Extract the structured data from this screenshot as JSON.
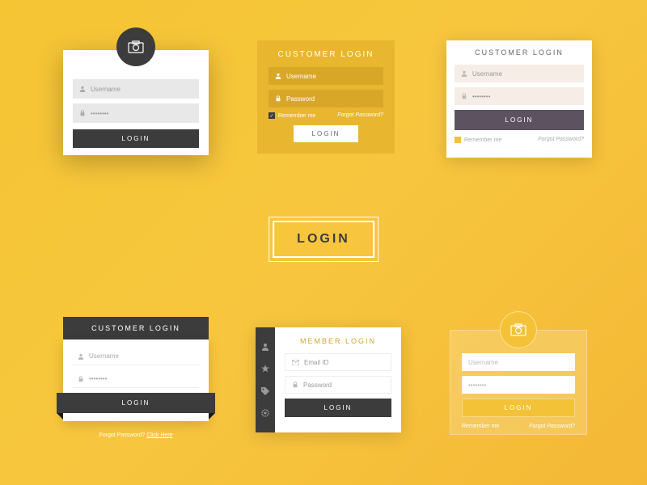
{
  "center": {
    "label": "LOGIN"
  },
  "card1": {
    "username_placeholder": "Username",
    "password_value": "••••••••",
    "login_label": "LOGIN"
  },
  "card2": {
    "title": "CUSTOMER LOGIN",
    "username_placeholder": "Username",
    "password_placeholder": "Password",
    "remember_label": "Remember me",
    "forgot_label": "Forgot Password?",
    "login_label": "LOGIN"
  },
  "card3": {
    "title": "CUSTOMER LOGIN",
    "username_placeholder": "Username",
    "password_value": "••••••••",
    "login_label": "LOGIN",
    "remember_label": "Remember me",
    "forgot_label": "Forgot Password?"
  },
  "card4": {
    "title": "CUSTOMER LOGIN",
    "username_placeholder": "Username",
    "password_value": "••••••••",
    "login_label": "LOGIN",
    "forgot_text": "Forgot Password? ",
    "forgot_link": "Click Here"
  },
  "card5": {
    "title": "MEMBER LOGIN",
    "email_placeholder": "Email ID",
    "password_placeholder": "Password",
    "login_label": "LOGIN"
  },
  "card6": {
    "username_placeholder": "Username",
    "password_value": "••••••••",
    "login_label": "LOGIN",
    "remember_label": "Remember me",
    "forgot_label": "Forgot Password?"
  }
}
